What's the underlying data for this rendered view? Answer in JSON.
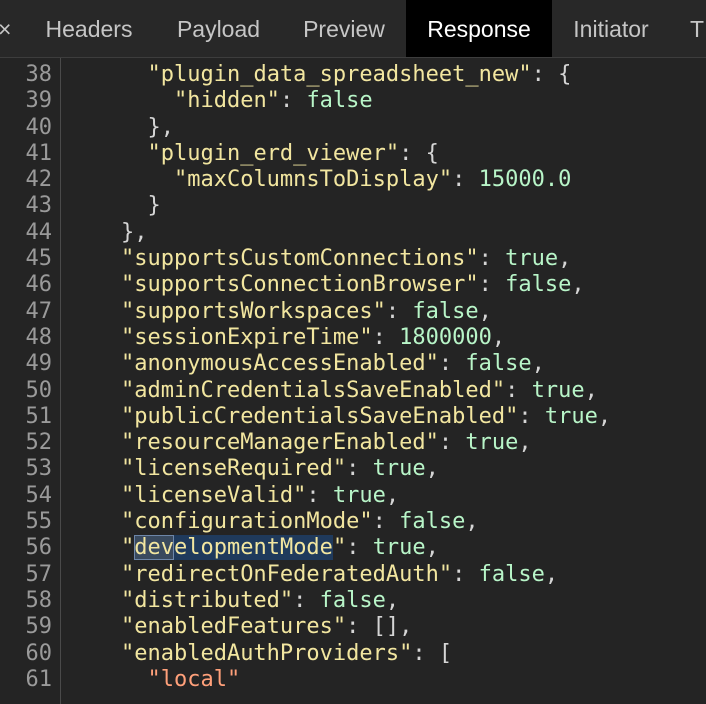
{
  "tabs": [
    {
      "label": "Headers"
    },
    {
      "label": "Payload"
    },
    {
      "label": "Preview"
    },
    {
      "label": "Response"
    },
    {
      "label": "Initiator"
    },
    {
      "label": "T"
    }
  ],
  "close_glyph": "×",
  "active_tab": "Response",
  "lines": [
    {
      "n": "38",
      "segs": [
        {
          "t": "      "
        },
        {
          "t": "\"plugin_data_spreadsheet_new\"",
          "c": "key"
        },
        {
          "t": ": {",
          "c": "punc"
        }
      ]
    },
    {
      "n": "39",
      "segs": [
        {
          "t": "        "
        },
        {
          "t": "\"hidden\"",
          "c": "key"
        },
        {
          "t": ": ",
          "c": "punc"
        },
        {
          "t": "false",
          "c": "bool"
        }
      ]
    },
    {
      "n": "40",
      "segs": [
        {
          "t": "      },",
          "c": "punc"
        }
      ]
    },
    {
      "n": "41",
      "segs": [
        {
          "t": "      "
        },
        {
          "t": "\"plugin_erd_viewer\"",
          "c": "key"
        },
        {
          "t": ": {",
          "c": "punc"
        }
      ]
    },
    {
      "n": "42",
      "segs": [
        {
          "t": "        "
        },
        {
          "t": "\"maxColumnsToDisplay\"",
          "c": "key"
        },
        {
          "t": ": ",
          "c": "punc"
        },
        {
          "t": "15000.0",
          "c": "num"
        }
      ]
    },
    {
      "n": "43",
      "segs": [
        {
          "t": "      }",
          "c": "punc"
        }
      ]
    },
    {
      "n": "44",
      "segs": [
        {
          "t": "    },",
          "c": "punc"
        }
      ]
    },
    {
      "n": "45",
      "segs": [
        {
          "t": "    "
        },
        {
          "t": "\"supportsCustomConnections\"",
          "c": "key"
        },
        {
          "t": ": ",
          "c": "punc"
        },
        {
          "t": "true",
          "c": "bool"
        },
        {
          "t": ",",
          "c": "punc"
        }
      ]
    },
    {
      "n": "46",
      "segs": [
        {
          "t": "    "
        },
        {
          "t": "\"supportsConnectionBrowser\"",
          "c": "key"
        },
        {
          "t": ": ",
          "c": "punc"
        },
        {
          "t": "false",
          "c": "bool"
        },
        {
          "t": ",",
          "c": "punc"
        }
      ]
    },
    {
      "n": "47",
      "segs": [
        {
          "t": "    "
        },
        {
          "t": "\"supportsWorkspaces\"",
          "c": "key"
        },
        {
          "t": ": ",
          "c": "punc"
        },
        {
          "t": "false",
          "c": "bool"
        },
        {
          "t": ",",
          "c": "punc"
        }
      ]
    },
    {
      "n": "48",
      "segs": [
        {
          "t": "    "
        },
        {
          "t": "\"sessionExpireTime\"",
          "c": "key"
        },
        {
          "t": ": ",
          "c": "punc"
        },
        {
          "t": "1800000",
          "c": "num"
        },
        {
          "t": ",",
          "c": "punc"
        }
      ]
    },
    {
      "n": "49",
      "segs": [
        {
          "t": "    "
        },
        {
          "t": "\"anonymousAccessEnabled\"",
          "c": "key"
        },
        {
          "t": ": ",
          "c": "punc"
        },
        {
          "t": "false",
          "c": "bool"
        },
        {
          "t": ",",
          "c": "punc"
        }
      ]
    },
    {
      "n": "50",
      "segs": [
        {
          "t": "    "
        },
        {
          "t": "\"adminCredentialsSaveEnabled\"",
          "c": "key"
        },
        {
          "t": ": ",
          "c": "punc"
        },
        {
          "t": "true",
          "c": "bool"
        },
        {
          "t": ",",
          "c": "punc"
        }
      ]
    },
    {
      "n": "51",
      "segs": [
        {
          "t": "    "
        },
        {
          "t": "\"publicCredentialsSaveEnabled\"",
          "c": "key"
        },
        {
          "t": ": ",
          "c": "punc"
        },
        {
          "t": "true",
          "c": "bool"
        },
        {
          "t": ",",
          "c": "punc"
        }
      ]
    },
    {
      "n": "52",
      "segs": [
        {
          "t": "    "
        },
        {
          "t": "\"resourceManagerEnabled\"",
          "c": "key"
        },
        {
          "t": ": ",
          "c": "punc"
        },
        {
          "t": "true",
          "c": "bool"
        },
        {
          "t": ",",
          "c": "punc"
        }
      ]
    },
    {
      "n": "53",
      "segs": [
        {
          "t": "    "
        },
        {
          "t": "\"licenseRequired\"",
          "c": "key"
        },
        {
          "t": ": ",
          "c": "punc"
        },
        {
          "t": "true",
          "c": "bool"
        },
        {
          "t": ",",
          "c": "punc"
        }
      ]
    },
    {
      "n": "54",
      "segs": [
        {
          "t": "    "
        },
        {
          "t": "\"licenseValid\"",
          "c": "key"
        },
        {
          "t": ": ",
          "c": "punc"
        },
        {
          "t": "true",
          "c": "bool"
        },
        {
          "t": ",",
          "c": "punc"
        }
      ]
    },
    {
      "n": "55",
      "segs": [
        {
          "t": "    "
        },
        {
          "t": "\"configurationMode\"",
          "c": "key"
        },
        {
          "t": ": ",
          "c": "punc"
        },
        {
          "t": "false",
          "c": "bool"
        },
        {
          "t": ",",
          "c": "punc"
        }
      ]
    },
    {
      "n": "56",
      "segs": [
        {
          "t": "    "
        },
        {
          "t": "\"",
          "c": "key"
        },
        {
          "t": "dev",
          "c": "hl"
        },
        {
          "t": "elopmentMode",
          "c": "sel"
        },
        {
          "t": "\"",
          "c": "key"
        },
        {
          "t": ": ",
          "c": "punc"
        },
        {
          "t": "true",
          "c": "bool"
        },
        {
          "t": ",",
          "c": "punc"
        }
      ]
    },
    {
      "n": "57",
      "segs": [
        {
          "t": "    "
        },
        {
          "t": "\"redirectOnFederatedAuth\"",
          "c": "key"
        },
        {
          "t": ": ",
          "c": "punc"
        },
        {
          "t": "false",
          "c": "bool"
        },
        {
          "t": ",",
          "c": "punc"
        }
      ]
    },
    {
      "n": "58",
      "segs": [
        {
          "t": "    "
        },
        {
          "t": "\"distributed\"",
          "c": "key"
        },
        {
          "t": ": ",
          "c": "punc"
        },
        {
          "t": "false",
          "c": "bool"
        },
        {
          "t": ",",
          "c": "punc"
        }
      ]
    },
    {
      "n": "59",
      "segs": [
        {
          "t": "    "
        },
        {
          "t": "\"enabledFeatures\"",
          "c": "key"
        },
        {
          "t": ": [],",
          "c": "punc"
        }
      ]
    },
    {
      "n": "60",
      "segs": [
        {
          "t": "    "
        },
        {
          "t": "\"enabledAuthProviders\"",
          "c": "key"
        },
        {
          "t": ": [",
          "c": "punc"
        }
      ]
    },
    {
      "n": "61",
      "segs": [
        {
          "t": "      "
        },
        {
          "t": "\"local\"",
          "c": "str"
        }
      ]
    }
  ]
}
